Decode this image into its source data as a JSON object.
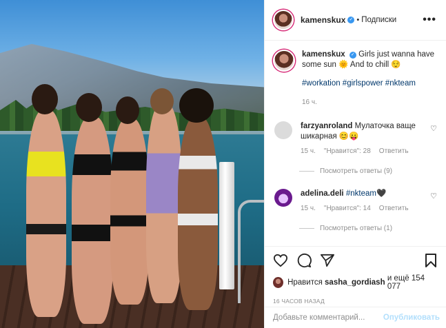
{
  "post": {
    "username": "kamenskux",
    "follow_label": "Подписки",
    "dot": "•",
    "more_label": "•••",
    "caption_text": "Girls just wanna have some sun 🌞 And to chill 😌",
    "hashtags": "#workation #girlspower #nkteam",
    "caption_time": "16 ч."
  },
  "comments": [
    {
      "user": "farzyanroland",
      "text": "Мулаточка ваще шикарная 😊😛",
      "time": "15 ч.",
      "likes": "\"Нравится\": 28",
      "reply": "Ответить",
      "view_replies": "Посмотреть ответы (9)"
    },
    {
      "user": "adelina.deli",
      "text": "#nkteam🖤",
      "time": "15 ч.",
      "likes": "\"Нравится\": 14",
      "reply": "Ответить",
      "view_replies": "Посмотреть ответы (1)"
    }
  ],
  "likes_line": {
    "prefix": "Нравится",
    "user": "sasha_gordiash",
    "suffix": "и ещё 154 077"
  },
  "posted_ago": "16 ЧАСОВ НАЗАД",
  "comment_box": {
    "placeholder": "Добавьте комментарий...",
    "post_label": "Опубликовать"
  },
  "colors": {
    "link": "#00376b",
    "verified": "#3897f0",
    "muted": "#8e8e8e",
    "post_disabled": "#b2dffc"
  },
  "icons": [
    "heart-icon",
    "comment-icon",
    "share-icon",
    "bookmark-icon",
    "verified-badge-icon",
    "more-options-icon"
  ]
}
